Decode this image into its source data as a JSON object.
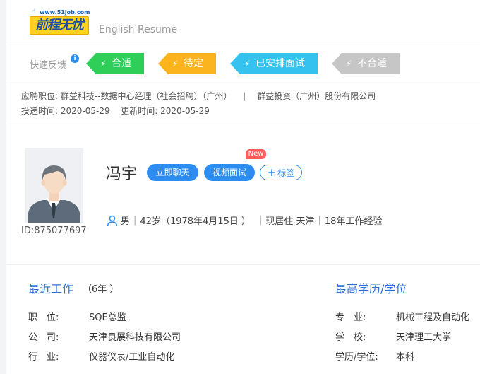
{
  "header": {
    "logo_site": "www.51job.com",
    "logo_text": "前程无忧",
    "subtitle": "English Resume"
  },
  "feedback": {
    "label": "快速反馈",
    "info_icon": "i",
    "tags": [
      {
        "label": "合适",
        "color": "#2fce59"
      },
      {
        "label": "待定",
        "color": "#fbb41e"
      },
      {
        "label": "已安排面试",
        "color": "#35c2ef"
      },
      {
        "label": "不合适",
        "color": "#c6c6c6"
      }
    ],
    "bolt_icon": "⚡"
  },
  "job": {
    "position_label": "应聘职位:",
    "position_value": "群益科技--数据中心经理（社会招聘）（广州）",
    "separator": "|",
    "company": "群益投资（广州）股份有限公司",
    "applied_label": "投递时间:",
    "applied_value": "2020-05-29",
    "updated_label": "更新时间:",
    "updated_value": "2020-05-29"
  },
  "profile": {
    "id_text": "ID:875077697",
    "name": "冯宇",
    "chat_button": "立即聊天",
    "video_button": "视频面试",
    "new_badge": "New",
    "tag_button_plus": "+",
    "tag_button": "标签",
    "gender": "男",
    "age": "42岁（1978年4月15日 ）",
    "residence": "现居住 天津",
    "experience": "18年工作经验"
  },
  "work": {
    "title": "最近工作",
    "years": "（6年 ）",
    "rows": [
      {
        "label": "职　位:",
        "value": "SQE总监"
      },
      {
        "label": "公　司:",
        "value": "天津良展科技有限公司"
      },
      {
        "label": "行　业:",
        "value": "仪器仪表/工业自动化"
      }
    ]
  },
  "education": {
    "title": "最高学历/学位",
    "rows": [
      {
        "label": "专　业:",
        "value": "机械工程及自动化"
      },
      {
        "label": "学　校:",
        "value": "天津理工大学"
      },
      {
        "label": "学历/学位:",
        "value": "本科"
      }
    ]
  },
  "colors": {
    "accent": "#2d8cf0",
    "section_title": "#2d6ed8",
    "new_badge": "#ff5c5c"
  }
}
